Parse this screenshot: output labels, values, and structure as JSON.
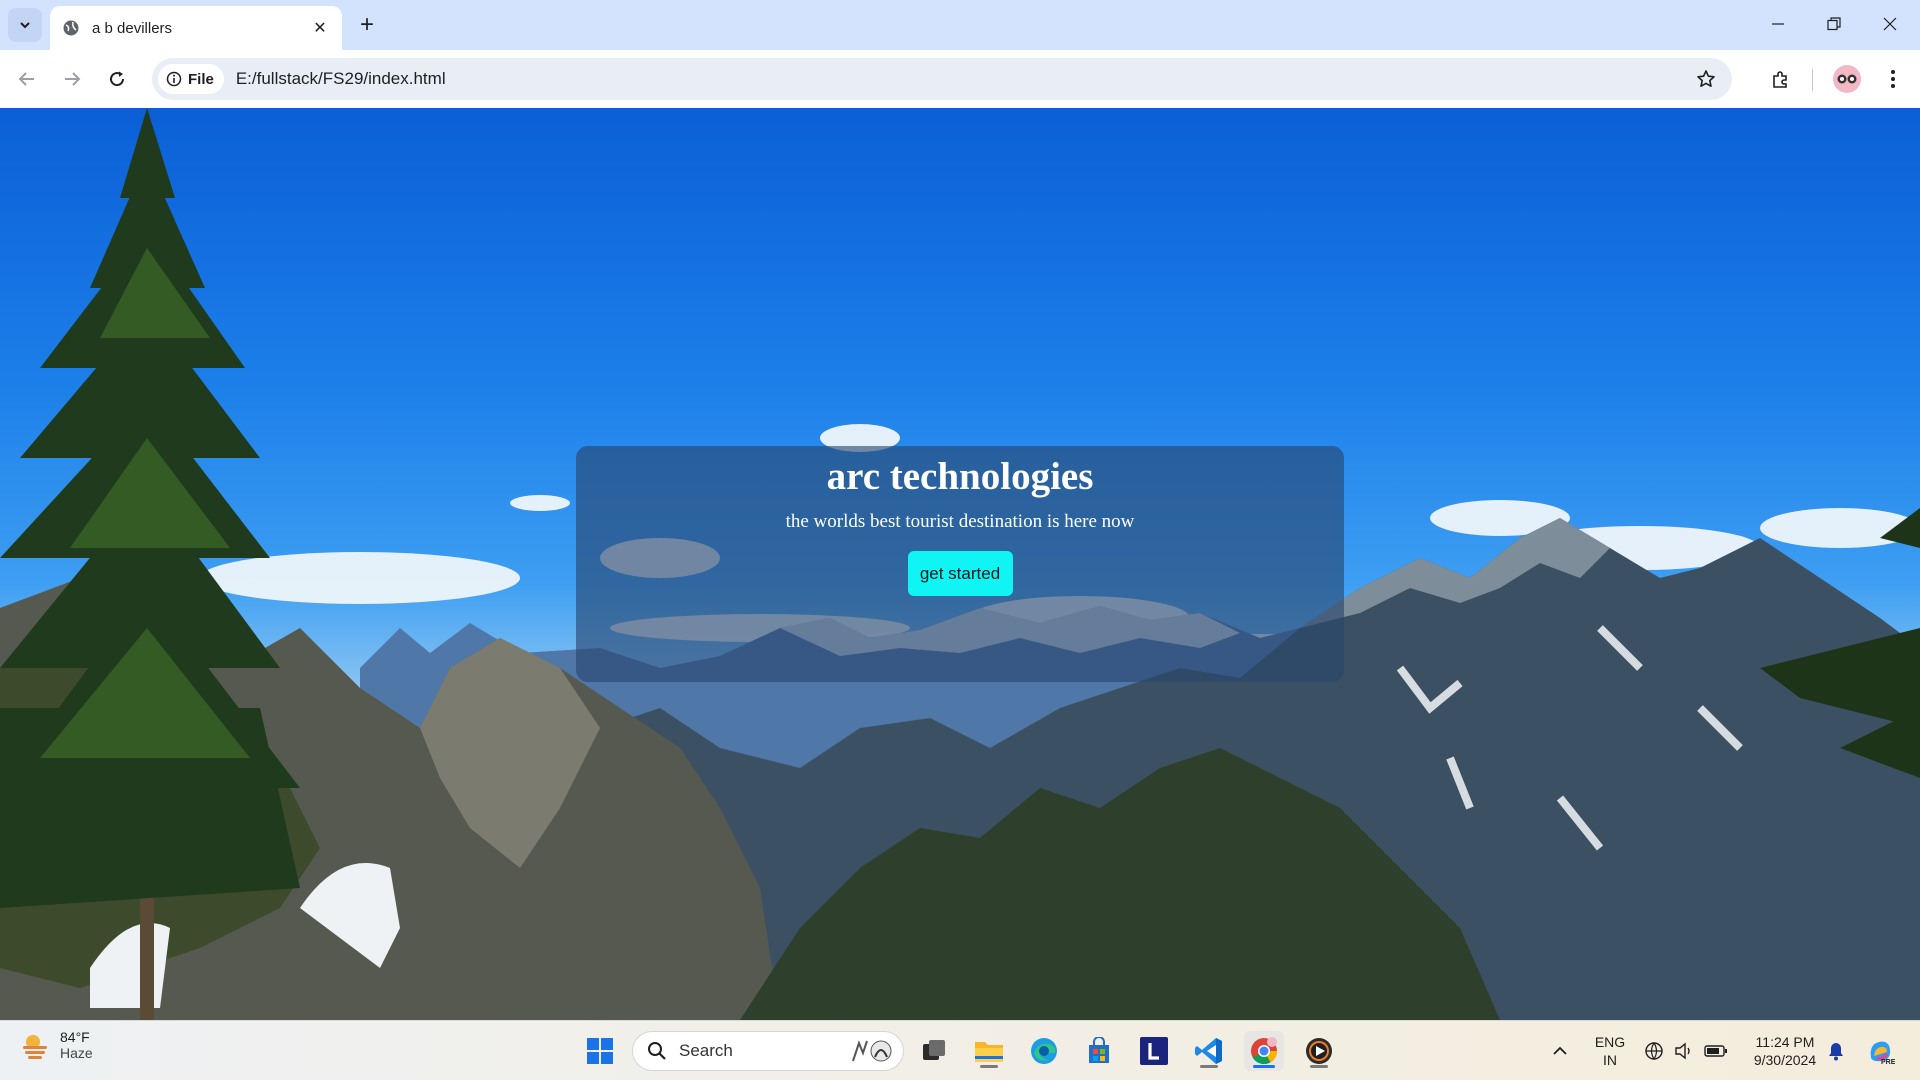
{
  "browser": {
    "tab_title": "a b devillers",
    "url_chip": "File",
    "url": "E:/fullstack/FS29/index.html",
    "icons": [
      "tab-search-icon",
      "globe-icon",
      "close-icon",
      "plus-icon",
      "minimize-icon",
      "restore-icon",
      "window-close-icon",
      "back-icon",
      "forward-icon",
      "reload-icon",
      "info-icon",
      "star-icon",
      "extensions-icon",
      "profile-icon",
      "menu-icon"
    ]
  },
  "page": {
    "heading": "arc technologies",
    "tagline": "the worlds best tourist destination is here now",
    "cta_label": "get started",
    "cta_color": "#10f4f4",
    "background": "mountain landscape with pine trees and blue sky"
  },
  "taskbar": {
    "weather_temp": "84°F",
    "weather_condition": "Haze",
    "search_label": "Search",
    "lang_line1": "ENG",
    "lang_line2": "IN",
    "time": "11:24 PM",
    "date": "9/30/2024",
    "apps": [
      "windows-start-icon",
      "search-icon",
      "task-view-icon",
      "file-explorer-icon",
      "edge-icon",
      "store-icon",
      "l-app-icon",
      "vscode-icon",
      "chrome-icon",
      "media-player-icon"
    ],
    "tray_icons": [
      "chevron-up-icon",
      "network-icon",
      "volume-icon",
      "battery-icon",
      "notification-bell-icon",
      "copilot-icon"
    ]
  }
}
